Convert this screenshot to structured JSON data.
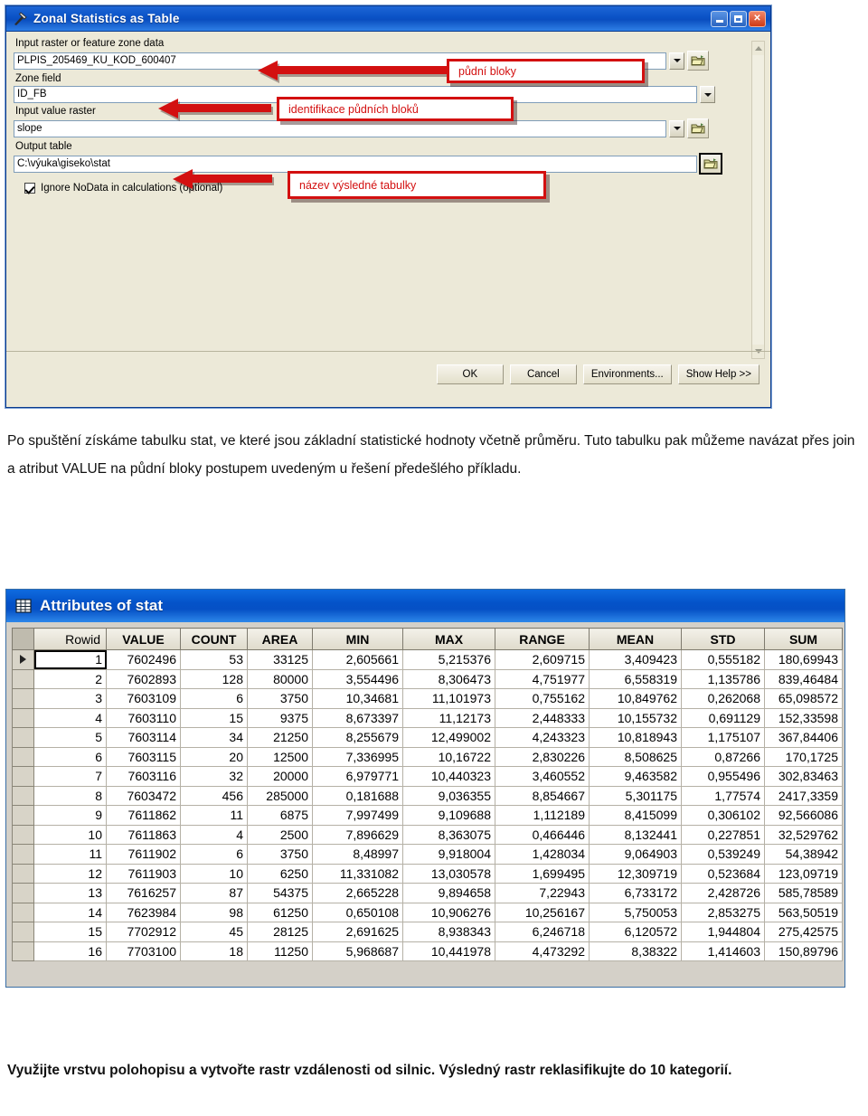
{
  "gp_dialog": {
    "title": "Zonal Statistics as Table",
    "tool_icon": "hammer-tool-icon",
    "window_buttons": {
      "minimize": "–",
      "maximize": "□",
      "close": "X"
    },
    "fields": [
      {
        "label": "Input raster or feature zone data",
        "value": "PLPIS_205469_KU_KOD_600407",
        "has_combo": true,
        "has_browse": true
      },
      {
        "label": "Zone field",
        "value": "ID_FB",
        "has_combo": true,
        "has_browse": false
      },
      {
        "label": "Input value raster",
        "value": "slope",
        "has_combo": true,
        "has_browse": true
      },
      {
        "label": "Output table",
        "value": "C:\\výuka\\giseko\\stat",
        "has_combo": false,
        "has_browse": true
      }
    ],
    "checkbox": {
      "label": "Ignore NoData in calculations (optional)",
      "checked": true
    },
    "buttons": [
      "OK",
      "Cancel",
      "Environments...",
      "Show Help >>"
    ],
    "callouts": [
      {
        "text": "půdní bloky"
      },
      {
        "text": "identifikace půdních bloků"
      },
      {
        "text": "název výsledné tabulky"
      }
    ],
    "accent_color": "#d31010",
    "titlebar_color": "#0a52c6"
  },
  "paragraphs": {
    "intro": "Po spuštění získáme tabulku stat, ve které jsou základní statistické hodnoty včetně průměru. Tuto tabulku pak můžeme navázat přes join a atribut VALUE na půdní bloky postupem uvedeným u řešení předešlého příkladu.",
    "task": "Využijte vrstvu polohopisu a vytvořte rastr vzdálenosti od silnic. Výsledný rastr reklasifikujte do 10 kategorií."
  },
  "attribute_table": {
    "title": "Attributes of stat",
    "icon": "grid-table-icon",
    "columns": [
      "Rowid",
      "VALUE",
      "COUNT",
      "AREA",
      "MIN",
      "MAX",
      "RANGE",
      "MEAN",
      "STD",
      "SUM"
    ],
    "selected_column": "Rowid",
    "current_row": 1,
    "rows": [
      [
        "1",
        "7602496",
        "53",
        "33125",
        "2,605661",
        "5,215376",
        "2,609715",
        "3,409423",
        "0,555182",
        "180,69943"
      ],
      [
        "2",
        "7602893",
        "128",
        "80000",
        "3,554496",
        "8,306473",
        "4,751977",
        "6,558319",
        "1,135786",
        "839,46484"
      ],
      [
        "3",
        "7603109",
        "6",
        "3750",
        "10,34681",
        "11,101973",
        "0,755162",
        "10,849762",
        "0,262068",
        "65,098572"
      ],
      [
        "4",
        "7603110",
        "15",
        "9375",
        "8,673397",
        "11,12173",
        "2,448333",
        "10,155732",
        "0,691129",
        "152,33598"
      ],
      [
        "5",
        "7603114",
        "34",
        "21250",
        "8,255679",
        "12,499002",
        "4,243323",
        "10,818943",
        "1,175107",
        "367,84406"
      ],
      [
        "6",
        "7603115",
        "20",
        "12500",
        "7,336995",
        "10,16722",
        "2,830226",
        "8,508625",
        "0,87266",
        "170,1725"
      ],
      [
        "7",
        "7603116",
        "32",
        "20000",
        "6,979771",
        "10,440323",
        "3,460552",
        "9,463582",
        "0,955496",
        "302,83463"
      ],
      [
        "8",
        "7603472",
        "456",
        "285000",
        "0,181688",
        "9,036355",
        "8,854667",
        "5,301175",
        "1,77574",
        "2417,3359"
      ],
      [
        "9",
        "7611862",
        "11",
        "6875",
        "7,997499",
        "9,109688",
        "1,112189",
        "8,415099",
        "0,306102",
        "92,566086"
      ],
      [
        "10",
        "7611863",
        "4",
        "2500",
        "7,896629",
        "8,363075",
        "0,466446",
        "8,132441",
        "0,227851",
        "32,529762"
      ],
      [
        "11",
        "7611902",
        "6",
        "3750",
        "8,48997",
        "9,918004",
        "1,428034",
        "9,064903",
        "0,539249",
        "54,38942"
      ],
      [
        "12",
        "7611903",
        "10",
        "6250",
        "11,331082",
        "13,030578",
        "1,699495",
        "12,309719",
        "0,523684",
        "123,09719"
      ],
      [
        "13",
        "7616257",
        "87",
        "54375",
        "2,665228",
        "9,894658",
        "7,22943",
        "6,733172",
        "2,428726",
        "585,78589"
      ],
      [
        "14",
        "7623984",
        "98",
        "61250",
        "0,650108",
        "10,906276",
        "10,256167",
        "5,750053",
        "2,853275",
        "563,50519"
      ],
      [
        "15",
        "7702912",
        "45",
        "28125",
        "2,691625",
        "8,938343",
        "6,246718",
        "6,120572",
        "1,944804",
        "275,42575"
      ],
      [
        "16",
        "7703100",
        "18",
        "11250",
        "5,968687",
        "10,441978",
        "4,473292",
        "8,38322",
        "1,414603",
        "150,89796"
      ]
    ]
  }
}
